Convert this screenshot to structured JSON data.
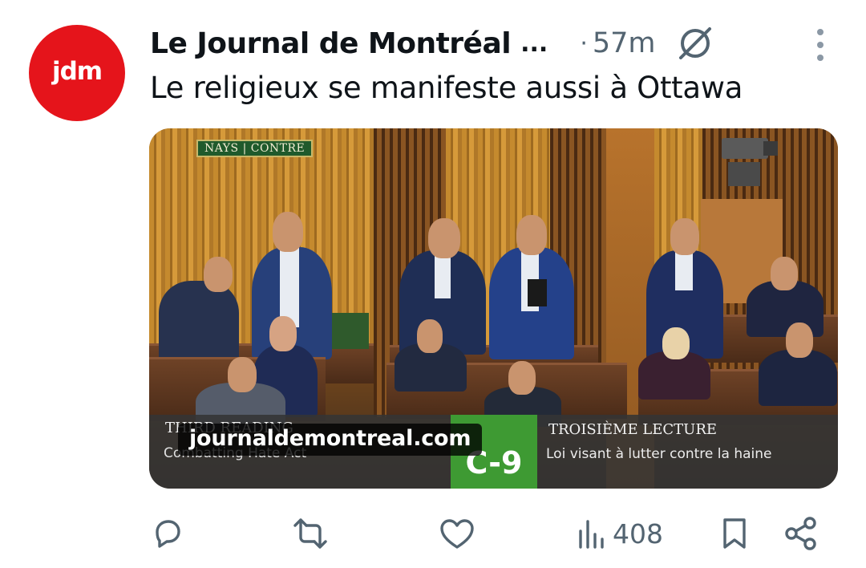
{
  "post": {
    "avatar_text": "jdm",
    "author": "Le Journal de Montréal",
    "author_truncation": "...",
    "separator": "·",
    "time": "57m",
    "text": "Le religieux se manifeste aussi à Ottawa"
  },
  "media": {
    "vote_badge": "NAYS | CONTRE",
    "en_title": "THIRD READING",
    "en_subtitle": "Combatting Hate Act",
    "bill_number": "C-9",
    "fr_title": "TROISIÈME LECTURE",
    "fr_subtitle": "Loi visant à lutter contre la haine",
    "link_domain": "journaldemontreal.com"
  },
  "actions": {
    "views": "408",
    "icons": [
      "reply-icon",
      "repost-icon",
      "like-icon",
      "views-icon",
      "bookmark-icon",
      "share-icon"
    ]
  },
  "colors": {
    "avatar_bg": "#e5141b",
    "secondary_text": "#536471",
    "bill_green": "#3e9a33"
  }
}
